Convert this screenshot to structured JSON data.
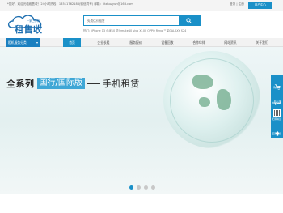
{
  "topbar": {
    "text": "*您好，欢迎光临租售收！24小时热线：18511762186(微信同号)  邮箱：jitzhuzyun@163.com",
    "login_text": "登录 | 注册",
    "user_center_label": "用户中心"
  },
  "logo": {
    "main_text": "租售收",
    "small_text": "一家二手机",
    "icon": "cloud-logo-icon"
  },
  "search": {
    "placeholder": "免费估价租赁",
    "button_icon": "search-icon",
    "hotwords": "热门：iPhone 13  小米10  华为mate40  vivo X100  OPPO Reno  三星GALAXY S24"
  },
  "nav": {
    "category_label": "租机服务分类",
    "category_icon": "chevron-down-icon",
    "items": [
      {
        "label": "首页",
        "active": true
      },
      {
        "label": "企业长租",
        "active": false
      },
      {
        "label": "服务报价",
        "active": false
      },
      {
        "label": "设备回收",
        "active": false
      },
      {
        "label": "合作伙伴",
        "active": false
      },
      {
        "label": "网站资讯",
        "active": false
      },
      {
        "label": "关于我们",
        "active": false
      }
    ]
  },
  "banner": {
    "left_text": "全系列",
    "box_text": "国行/国际版",
    "right_text": "手机租赁",
    "slides_total": 4,
    "slide_active": 1
  },
  "side": {
    "items": [
      {
        "label": "购物车",
        "icon": "cart-icon"
      },
      {
        "label": "在线咨询",
        "icon": "chat-icon"
      },
      {
        "label": "扫码关注",
        "icon": "qr-code-icon"
      },
      {
        "label": "回到顶部",
        "icon": "arrow-up-icon"
      }
    ]
  },
  "colors": {
    "accent": "#1a90c8",
    "logo_blue": "#1e6fb0",
    "banner_box": "#3fa7d6"
  }
}
